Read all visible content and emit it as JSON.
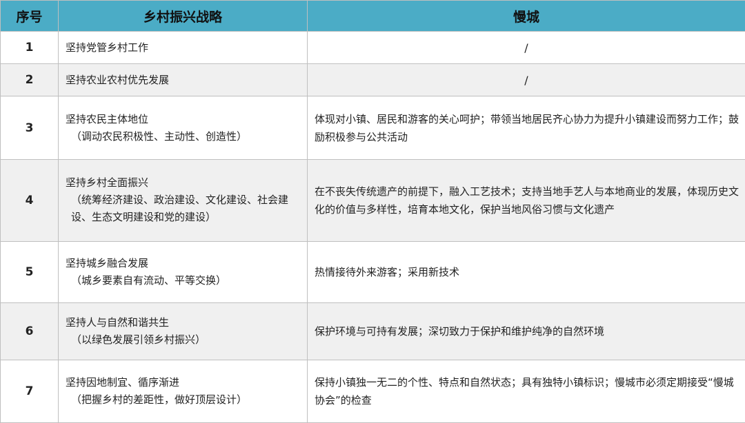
{
  "header": {
    "col_number": "序号",
    "col_strategy": "乡村振兴战略",
    "col_slowcity": "慢城"
  },
  "rows": [
    {
      "number": "1",
      "strategy_main": "坚持党管乡村工作",
      "strategy_sub": "",
      "slowcity": "/"
    },
    {
      "number": "2",
      "strategy_main": "坚持农业农村优先发展",
      "strategy_sub": "",
      "slowcity": "/"
    },
    {
      "number": "3",
      "strategy_main": "坚持农民主体地位",
      "strategy_sub": "（调动农民积极性、主动性、创造性）",
      "slowcity": "体现对小镇、居民和游客的关心呵护；带领当地居民齐心协力为提升小镇建设而努力工作；鼓励积极参与公共活动"
    },
    {
      "number": "4",
      "strategy_main": "坚持乡村全面振兴",
      "strategy_sub": "（统筹经济建设、政治建设、文化建设、社会建设、生态文明建设和党的建设）",
      "slowcity": "在不丧失传统遗产的前提下，融入工艺技术；支持当地手艺人与本地商业的发展，体现历史文化的价值与多样性，培育本地文化，保护当地风俗习惯与文化遗产"
    },
    {
      "number": "5",
      "strategy_main": "坚持城乡融合发展",
      "strategy_sub": "（城乡要素自有流动、平等交换）",
      "slowcity": "热情接待外来游客；采用新技术"
    },
    {
      "number": "6",
      "strategy_main": "坚持人与自然和谐共生",
      "strategy_sub": "（以绿色发展引领乡村振兴）",
      "slowcity": "保护环境与可持有发展；深切致力于保护和维护纯净的自然环境"
    },
    {
      "number": "7",
      "strategy_main": "坚持因地制宜、循序渐进",
      "strategy_sub": "（把握乡村的差距性，做好顶层设计）",
      "slowcity": "保持小镇独一无二的个性、特点和自然状态；具有独特小镇标识；慢城市必须定期接受“慢城协会”的检查"
    }
  ]
}
